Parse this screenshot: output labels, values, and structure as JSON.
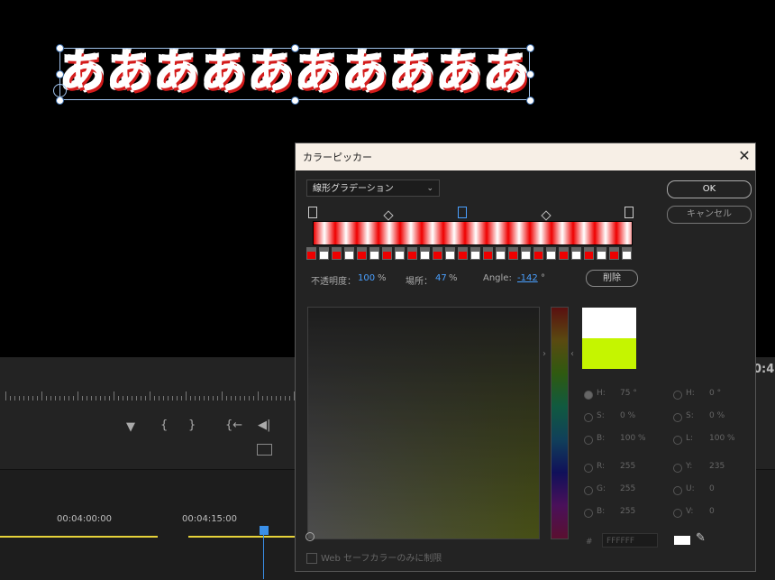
{
  "monitor": {
    "title_glyphs": [
      "あ",
      "あ",
      "あ",
      "あ",
      "あ",
      "あ",
      "あ",
      "あ",
      "あ",
      "あ"
    ],
    "timecode_right": "0:4"
  },
  "timeline": {
    "timecodes": [
      "00:04:00:00",
      "00:04:15:00"
    ],
    "controls": [
      "▼",
      "{",
      "}",
      "{←",
      "◀|",
      "▶"
    ]
  },
  "dialog": {
    "title": "カラーピッカー",
    "close_icon": "close-icon",
    "gradient_type": "線形グラデーション",
    "ok_label": "OK",
    "cancel_label": "キャンセル",
    "opacity_label": "不透明度：",
    "opacity_value": "100",
    "opacity_unit": "%",
    "location_label": "場所：",
    "location_value": "47",
    "location_unit": "%",
    "angle_label": "Angle:",
    "angle_value": "-142",
    "angle_unit": "°",
    "delete_label": "削除",
    "hsb": [
      {
        "label": "H:",
        "value": "75 °"
      },
      {
        "label": "S:",
        "value": "0 %"
      },
      {
        "label": "B:",
        "value": "100 %"
      }
    ],
    "hsl": [
      {
        "label": "H:",
        "value": "0 °"
      },
      {
        "label": "S:",
        "value": "0 %"
      },
      {
        "label": "L:",
        "value": "100 %"
      }
    ],
    "rgb": [
      {
        "label": "R:",
        "value": "255"
      },
      {
        "label": "G:",
        "value": "255"
      },
      {
        "label": "B:",
        "value": "255"
      }
    ],
    "yuv": [
      {
        "label": "Y:",
        "value": "235"
      },
      {
        "label": "U:",
        "value": "0"
      },
      {
        "label": "V:",
        "value": "0"
      }
    ],
    "hex_label": "#",
    "hex_value": "FFFFFF",
    "websafe_label": "Web セーフカラーのみに制限",
    "preview_new_color": "#ffffff",
    "preview_old_color": "#c5f500"
  }
}
